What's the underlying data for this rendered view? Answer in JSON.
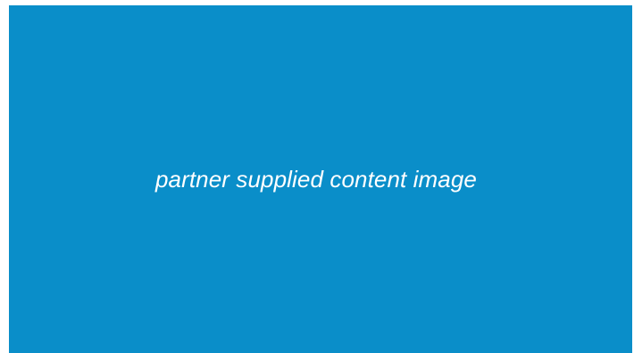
{
  "placeholder": {
    "text": "partner supplied content image",
    "background_color": "#0a8ec9",
    "text_color": "#ffffff"
  }
}
